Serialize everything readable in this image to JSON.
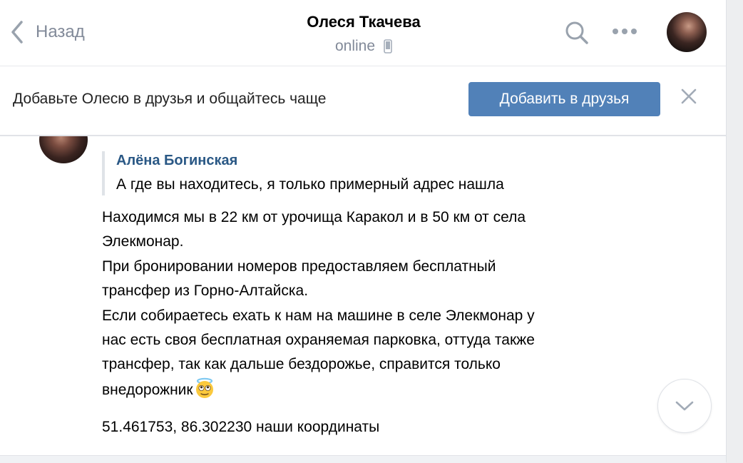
{
  "header": {
    "back_label": "Назад",
    "contact_name": "Олеся Ткачева",
    "status": "online"
  },
  "friend_bar": {
    "text": "Добавьте Олесю в друзья и общайтесь чаще",
    "add_button": "Добавить в друзья"
  },
  "message": {
    "quote": {
      "author": "Алёна Богинская",
      "text": "А где вы находитесь, я только примерный адрес нашла"
    },
    "lines": [
      "Находимся мы в 22 км от урочища Каракол и в 50 км от села",
      "Элекмонар.",
      "При бронировании номеров предоставляем бесплатный",
      "трансфер из Горно-Алтайска.",
      "Если собираетесь ехать к нам на машине в селе Элекмонар у",
      "нас есть своя бесплатная охраняемая парковка, оттуда также",
      "трансфер, так как дальше бездорожье, справится только",
      "внедорожник"
    ],
    "coords": "51.461753, 86.302230 наши координаты"
  },
  "colors": {
    "accent": "#5181b8",
    "link": "#2a5885",
    "muted": "#828a99"
  }
}
